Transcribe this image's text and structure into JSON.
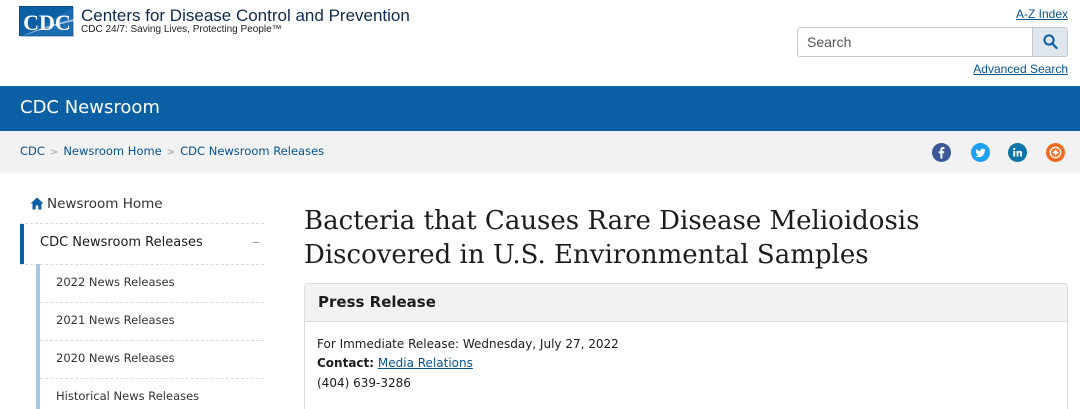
{
  "header": {
    "logo_text": "CDC",
    "org_name": "Centers for Disease Control and Prevention",
    "tagline": "CDC 24/7: Saving Lives, Protecting People™",
    "az_index": "A-Z Index",
    "search_placeholder": "Search",
    "advanced_search": "Advanced Search",
    "brand_color": "#0b5fa5"
  },
  "banner": {
    "title": "CDC Newsroom"
  },
  "breadcrumb": [
    "CDC",
    "Newsroom Home",
    "CDC Newsroom Releases"
  ],
  "social_icons": [
    "facebook-icon",
    "twitter-icon",
    "linkedin-icon",
    "syndicate-icon"
  ],
  "sidebar": {
    "home_label": "Newsroom Home",
    "active_label": "CDC Newsroom Releases",
    "active_marker": "–",
    "items": [
      {
        "label": "2022 News Releases"
      },
      {
        "label": "2021 News Releases"
      },
      {
        "label": "2020 News Releases"
      },
      {
        "label": "Historical News Releases"
      }
    ]
  },
  "article": {
    "title": "Bacteria that Causes Rare Disease Melioidosis Discovered in U.S. Environmental Samples",
    "card_title": "Press Release",
    "release_line": "For Immediate Release: Wednesday, July 27, 2022",
    "contact_label": "Contact:",
    "contact_link": "Media Relations",
    "phone": "(404) 639-3286"
  }
}
